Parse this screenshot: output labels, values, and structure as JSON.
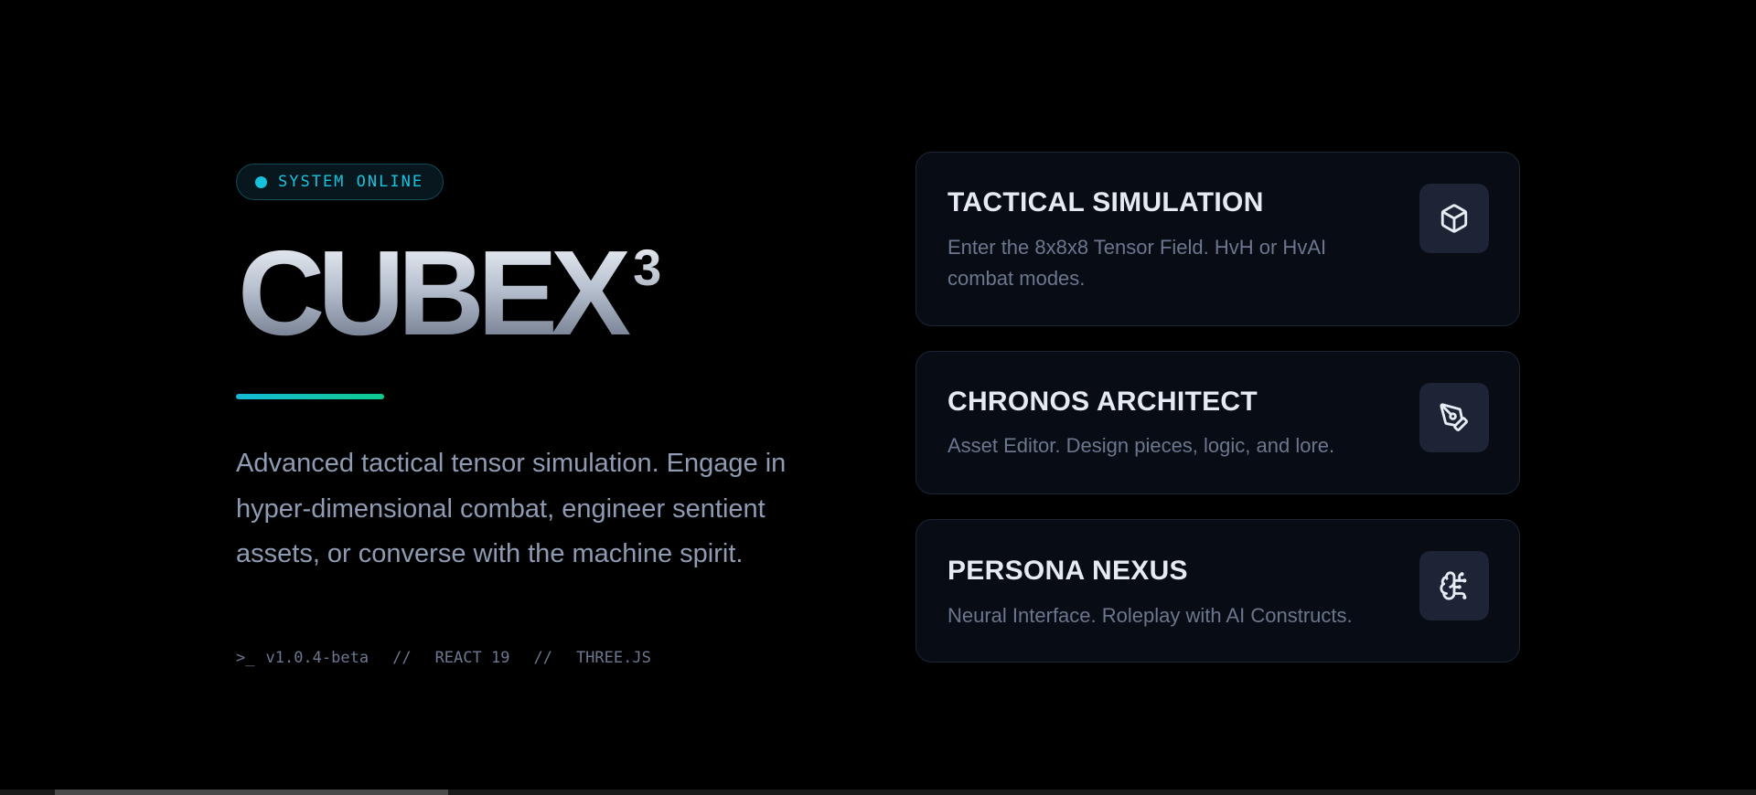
{
  "status_badge": {
    "label": "SYSTEM ONLINE",
    "color": "#19c3dc"
  },
  "hero": {
    "title": "CUBEX",
    "title_superscript": "3",
    "tagline": "Advanced tactical tensor simulation. Engage in hyper-dimensional combat, engineer sentient assets, or converse with the machine spirit."
  },
  "meta": {
    "prompt": ">_",
    "version": "v1.0.4-beta",
    "separator": "//",
    "framework": "REACT 19",
    "engine": "THREE.JS"
  },
  "cards": [
    {
      "title": "TACTICAL SIMULATION",
      "description": "Enter the 8x8x8 Tensor Field. HvH or HvAI combat modes.",
      "icon": "cube-icon"
    },
    {
      "title": "CHRONOS ARCHITECT",
      "description": "Asset Editor. Design pieces, logic, and lore.",
      "icon": "pen-tool-icon"
    },
    {
      "title": "PERSONA NEXUS",
      "description": "Neural Interface. Roleplay with AI Constructs.",
      "icon": "brain-icon"
    }
  ],
  "colors": {
    "accent_cyan": "#13b9d6",
    "accent_green": "#10c98e",
    "background": "#000000",
    "card_background": "#080c15"
  }
}
